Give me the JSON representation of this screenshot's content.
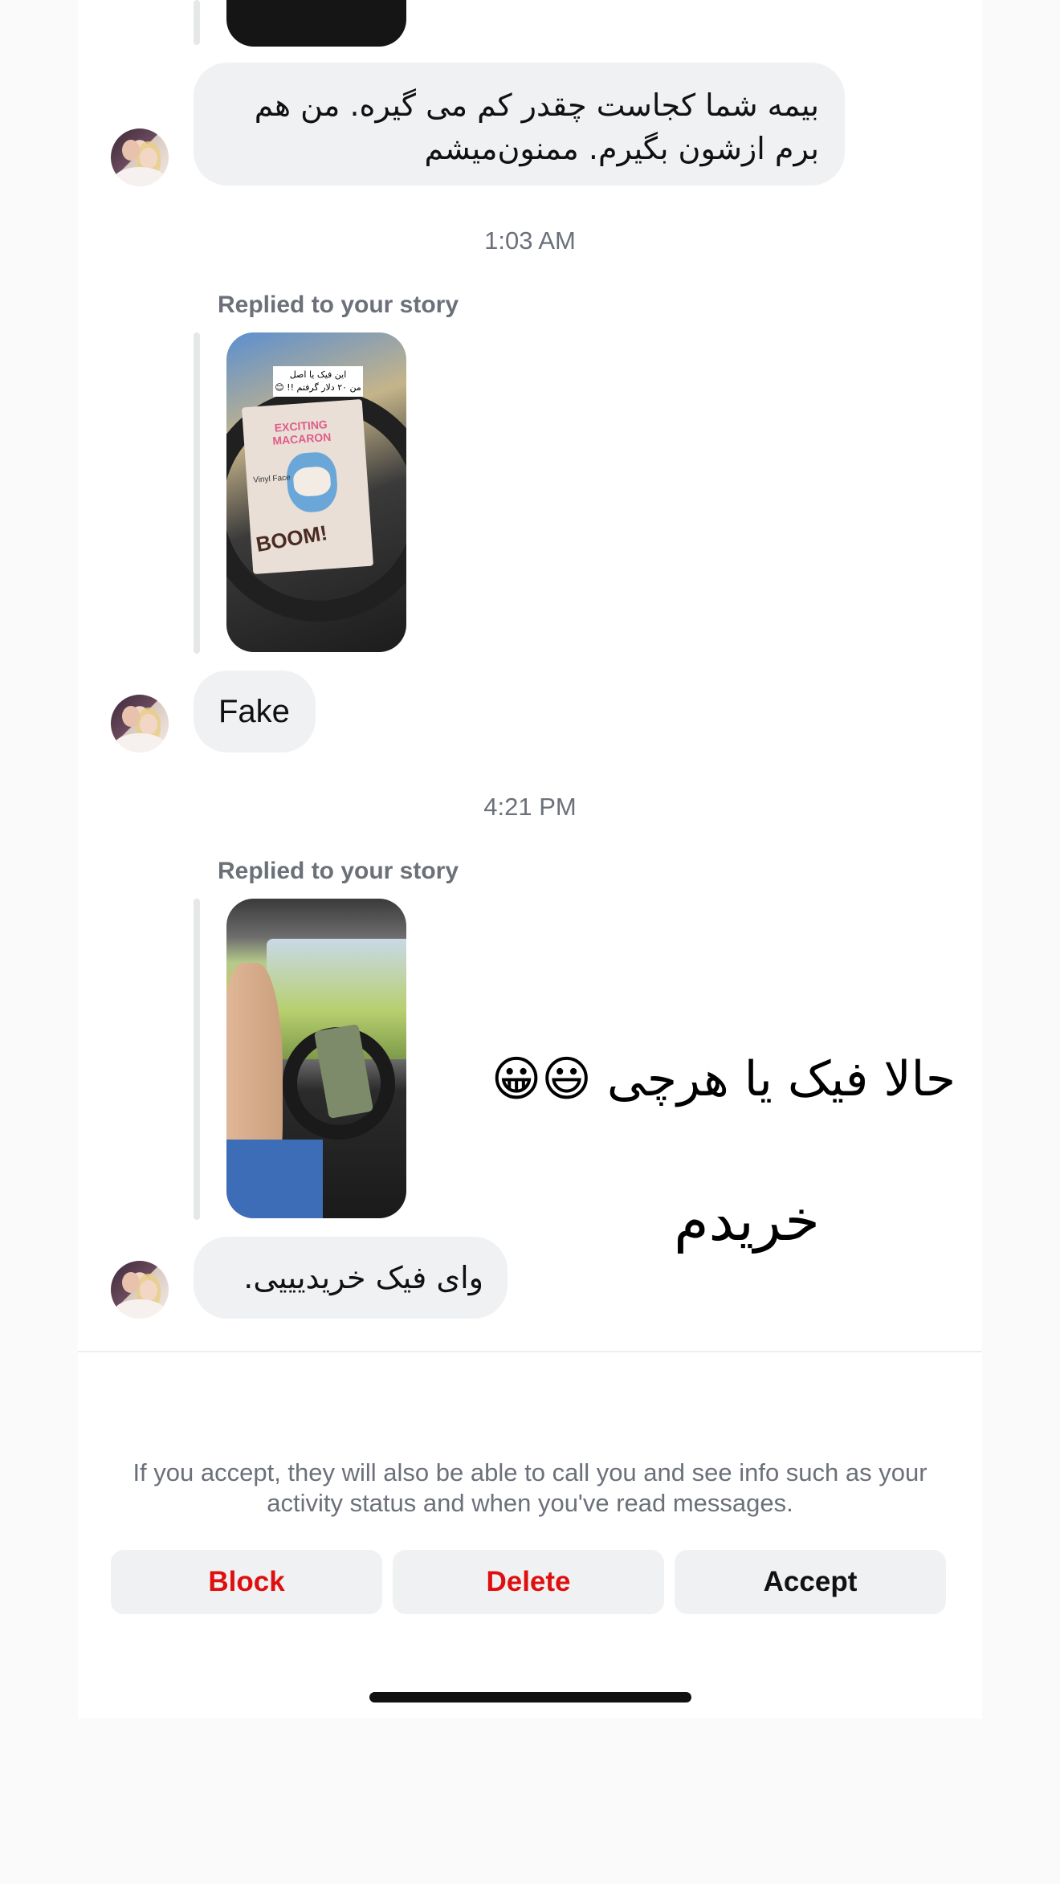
{
  "messages": {
    "m1_text": "بیمه شما کجاست چقدر کم می گیره. من هم برم ازشون بگیرم.  ممنون‌میشم",
    "time1": "1:03 AM",
    "replied_label_1": "Replied to your story",
    "story1_caption_line1": "این فیک یا اصل",
    "story1_caption_line2": "من ۲۰ دلار گرفتم !! 😊",
    "story1_box_title": "EXCITING MACARON",
    "story1_box_sub": "Vinyl Face",
    "story1_box_boom": "BOOM!",
    "m2_text": "Fake",
    "time2": "4:21 PM",
    "replied_label_2": "Replied to your story",
    "m3_text": "وای فیک خریدیییی."
  },
  "story_sticker": {
    "line1": "حالا فیک یا هرچی 😃😀",
    "line2": "خریدم"
  },
  "request_footer": {
    "info_text": "If you accept, they will also be able to call you and see info such as your activity status and when you've read messages.",
    "block_label": "Block",
    "delete_label": "Delete",
    "accept_label": "Accept"
  },
  "colors": {
    "danger": "#e00f0f",
    "bubble_bg": "#f0f1f3",
    "muted_text": "#6b7079"
  }
}
